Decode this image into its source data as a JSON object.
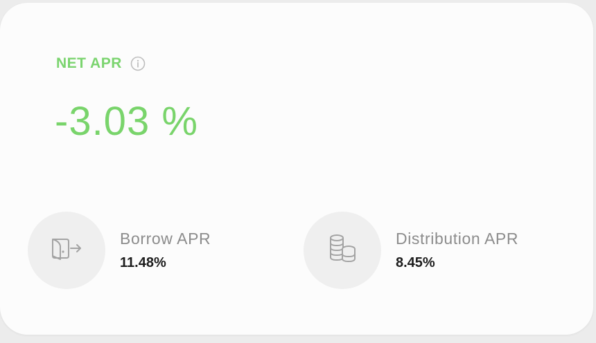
{
  "net_apr": {
    "label": "NET APR",
    "value": "-3.03 %",
    "info_icon": "info-circle-icon",
    "accent_color": "#7bd46f"
  },
  "stats": [
    {
      "label": "Borrow APR",
      "value": "11.48%",
      "icon": "wallet-arrow-out-icon"
    },
    {
      "label": "Distribution APR",
      "value": "8.45%",
      "icon": "coin-stacks-icon"
    }
  ]
}
